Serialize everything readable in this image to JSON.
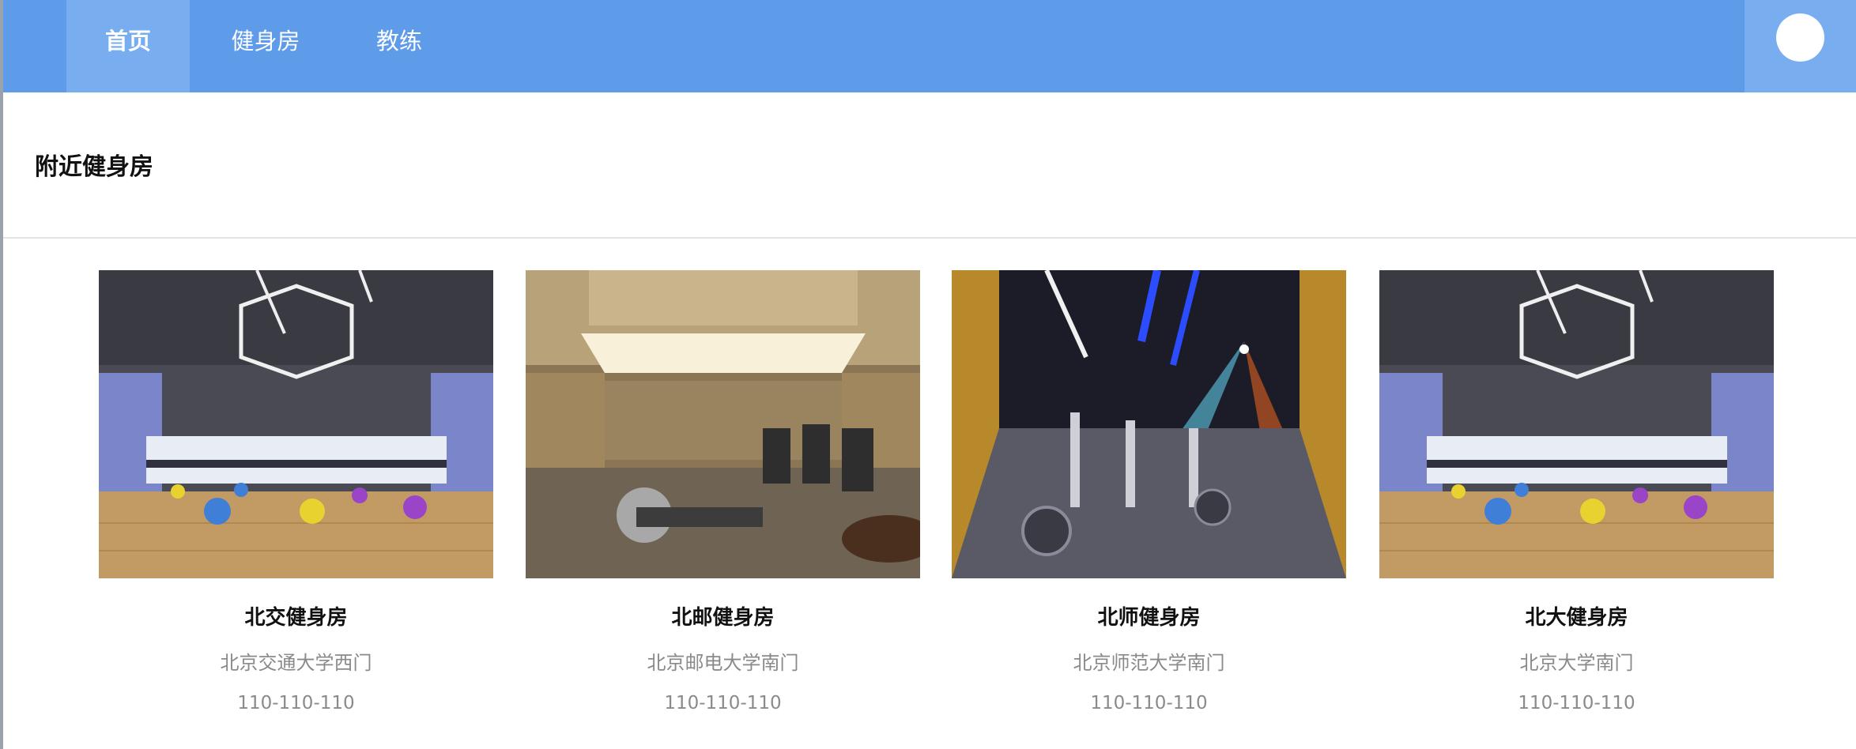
{
  "nav": {
    "items": [
      {
        "label": "首页",
        "active": true
      },
      {
        "label": "健身房",
        "active": false
      },
      {
        "label": "教练",
        "active": false
      }
    ]
  },
  "section": {
    "title": "附近健身房"
  },
  "gyms": [
    {
      "name": "北交健身房",
      "address": "北京交通大学西门",
      "phone": "110-110-110",
      "image": "gym-interior-lights"
    },
    {
      "name": "北邮健身房",
      "address": "北京邮电大学南门",
      "phone": "110-110-110",
      "image": "gym-treadmill-room"
    },
    {
      "name": "北师健身房",
      "address": "北京师范大学南门",
      "phone": "110-110-110",
      "image": "gym-spin-room"
    },
    {
      "name": "北大健身房",
      "address": "北京大学南门",
      "phone": "110-110-110",
      "image": "gym-interior-lights"
    }
  ],
  "colors": {
    "nav": "#5e9be8",
    "nav_active": "#78aef0"
  }
}
